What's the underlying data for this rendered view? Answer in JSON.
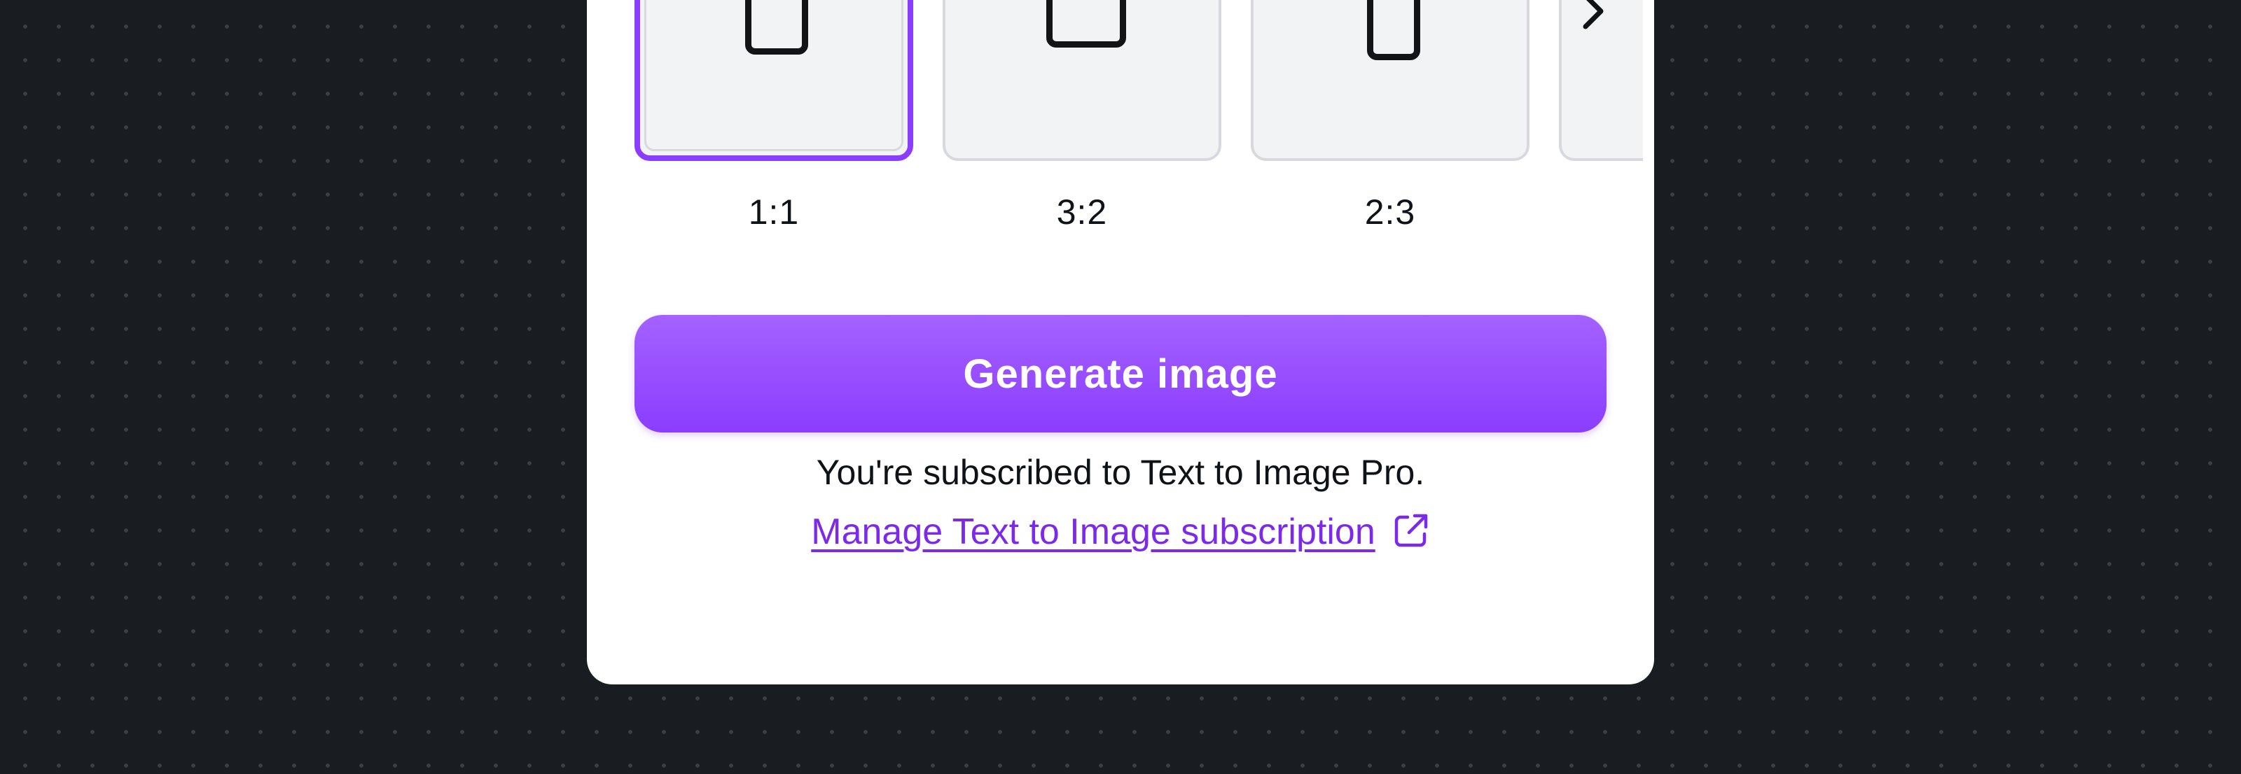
{
  "aspect_ratios": {
    "items": [
      {
        "label": "1:1",
        "selected": true
      },
      {
        "label": "3:2",
        "selected": false
      },
      {
        "label": "2:3",
        "selected": false
      }
    ]
  },
  "actions": {
    "generate_label": "Generate image"
  },
  "subscription": {
    "status_text": "You're subscribed to Text to Image Pro.",
    "manage_link_label": "Manage Text to Image subscription"
  },
  "icons": {
    "next": "chevron-right-icon",
    "external": "external-link-icon"
  },
  "colors": {
    "background": "#191c21",
    "accent": "#8b3dff",
    "link": "#7d2ae8",
    "panel": "#ffffff"
  }
}
